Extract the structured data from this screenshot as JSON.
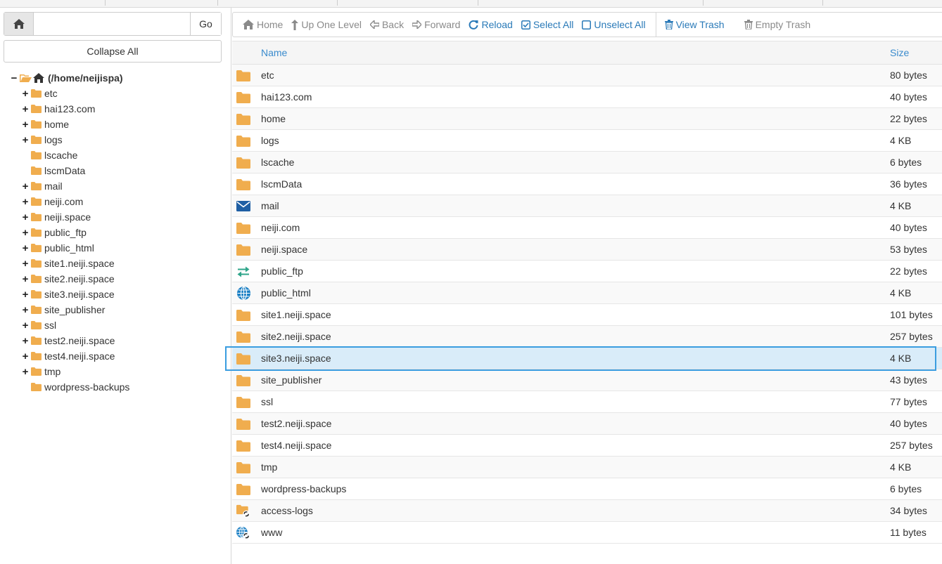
{
  "colors": {
    "folder": "#f0ad4e",
    "link_blue": "#2a7ab8",
    "disabled_grey": "#8a8a8a",
    "selected_row": "#d9ecf9",
    "selection_outline": "#3a9de0",
    "mail_icon": "#1f5fa4",
    "ftp_icon": "#2ea58a",
    "web_icon": "#1a7fc4"
  },
  "left_panel": {
    "path_input_value": "",
    "go_label": "Go",
    "collapse_label": "Collapse All",
    "tree": {
      "root_label": "(/home/neijispa)",
      "items": [
        {
          "label": "etc",
          "expandable": true
        },
        {
          "label": "hai123.com",
          "expandable": true
        },
        {
          "label": "home",
          "expandable": true
        },
        {
          "label": "logs",
          "expandable": true
        },
        {
          "label": "lscache",
          "expandable": false
        },
        {
          "label": "lscmData",
          "expandable": false
        },
        {
          "label": "mail",
          "expandable": true
        },
        {
          "label": "neiji.com",
          "expandable": true
        },
        {
          "label": "neiji.space",
          "expandable": true
        },
        {
          "label": "public_ftp",
          "expandable": true
        },
        {
          "label": "public_html",
          "expandable": true
        },
        {
          "label": "site1.neiji.space",
          "expandable": true
        },
        {
          "label": "site2.neiji.space",
          "expandable": true
        },
        {
          "label": "site3.neiji.space",
          "expandable": true
        },
        {
          "label": "site_publisher",
          "expandable": true
        },
        {
          "label": "ssl",
          "expandable": true
        },
        {
          "label": "test2.neiji.space",
          "expandable": true
        },
        {
          "label": "test4.neiji.space",
          "expandable": true
        },
        {
          "label": "tmp",
          "expandable": true
        },
        {
          "label": "wordpress-backups",
          "expandable": false
        }
      ]
    }
  },
  "toolbar": {
    "home": "Home",
    "up_one_level": "Up One Level",
    "back": "Back",
    "forward": "Forward",
    "reload": "Reload",
    "select_all": "Select All",
    "unselect_all": "Unselect All",
    "view_trash": "View Trash",
    "empty_trash": "Empty Trash"
  },
  "table": {
    "col_name": "Name",
    "col_size": "Size",
    "rows": [
      {
        "icon": "folder-icon",
        "name": "etc",
        "size": "80 bytes"
      },
      {
        "icon": "folder-icon",
        "name": "hai123.com",
        "size": "40 bytes"
      },
      {
        "icon": "folder-icon",
        "name": "home",
        "size": "22 bytes"
      },
      {
        "icon": "folder-icon",
        "name": "logs",
        "size": "4 KB"
      },
      {
        "icon": "folder-icon",
        "name": "lscache",
        "size": "6 bytes"
      },
      {
        "icon": "folder-icon",
        "name": "lscmData",
        "size": "36 bytes"
      },
      {
        "icon": "mail-icon",
        "name": "mail",
        "size": "4 KB"
      },
      {
        "icon": "folder-icon",
        "name": "neiji.com",
        "size": "40 bytes"
      },
      {
        "icon": "folder-icon",
        "name": "neiji.space",
        "size": "53 bytes"
      },
      {
        "icon": "ftp-transfer-icon",
        "name": "public_ftp",
        "size": "22 bytes"
      },
      {
        "icon": "globe-icon",
        "name": "public_html",
        "size": "4 KB"
      },
      {
        "icon": "folder-icon",
        "name": "site1.neiji.space",
        "size": "101 bytes"
      },
      {
        "icon": "folder-icon",
        "name": "site2.neiji.space",
        "size": "257 bytes"
      },
      {
        "icon": "folder-icon",
        "name": "site3.neiji.space",
        "size": "4 KB",
        "selected": true
      },
      {
        "icon": "folder-icon",
        "name": "site_publisher",
        "size": "43 bytes"
      },
      {
        "icon": "folder-icon",
        "name": "ssl",
        "size": "77 bytes"
      },
      {
        "icon": "folder-icon",
        "name": "test2.neiji.space",
        "size": "40 bytes"
      },
      {
        "icon": "folder-icon",
        "name": "test4.neiji.space",
        "size": "257 bytes"
      },
      {
        "icon": "folder-icon",
        "name": "tmp",
        "size": "4 KB"
      },
      {
        "icon": "folder-icon",
        "name": "wordpress-backups",
        "size": "6 bytes"
      },
      {
        "icon": "folder-link-icon",
        "name": "access-logs",
        "size": "34 bytes"
      },
      {
        "icon": "globe-link-icon",
        "name": "www",
        "size": "11 bytes"
      }
    ]
  }
}
